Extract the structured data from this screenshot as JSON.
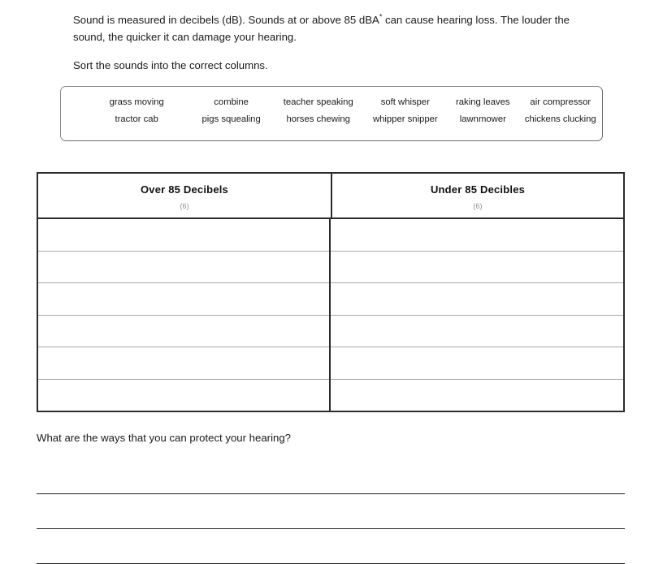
{
  "intro": {
    "line1_before_sup": "Sound is measured in decibels (dB). Sounds at or above 85 dBA",
    "sup": "*",
    "line1_after_sup": " can cause hearing loss. The louder the",
    "line2": "sound, the quicker it can damage your hearing.",
    "instruction": "Sort the sounds into the correct columns."
  },
  "word_bank": {
    "rows": [
      [
        "grass moving",
        "combine",
        "teacher speaking",
        "soft whisper",
        "raking leaves",
        "air compressor"
      ],
      [
        "tractor cab",
        "pigs squealing",
        "horses chewing",
        "whipper snipper",
        "lawnmower",
        "chickens clucking"
      ]
    ]
  },
  "sort_table": {
    "columns": [
      {
        "title": "Over 85 Decibels",
        "count": "(6)"
      },
      {
        "title": "Under 85 Decibles",
        "count": "(6)"
      }
    ],
    "row_count": 6,
    "left_answers": [
      "",
      "",
      "",
      "",
      "",
      ""
    ],
    "right_answers": [
      "",
      "",
      "",
      "",
      "",
      ""
    ]
  },
  "closing": {
    "question": "What are the ways that you can protect your hearing?",
    "line_count": 3
  },
  "colors": {
    "text": "#1a1a1a",
    "table_border": "#2b2b2b",
    "row_divider": "#a9a9a9",
    "word_bank_border": "#8a8a8a",
    "count_text": "#8d8d8d",
    "page_background": "#ffffff"
  }
}
